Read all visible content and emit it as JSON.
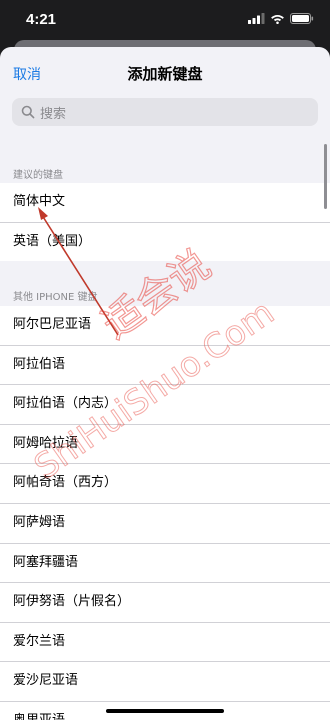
{
  "status_bar": {
    "time": "4:21"
  },
  "nav": {
    "cancel_label": "取消",
    "title": "添加新键盘"
  },
  "search": {
    "placeholder": "搜索"
  },
  "suggested": {
    "header": "建议的键盘",
    "items": [
      {
        "label": "简体中文"
      },
      {
        "label": "英语（美国）"
      }
    ]
  },
  "others": {
    "header": "其他 IPHONE 键盘",
    "items": [
      {
        "label": "阿尔巴尼亚语"
      },
      {
        "label": "阿拉伯语"
      },
      {
        "label": "阿拉伯语（内志）"
      },
      {
        "label": "阿姆哈拉语"
      },
      {
        "label": "阿帕奇语（西方）"
      },
      {
        "label": "阿萨姆语"
      },
      {
        "label": "阿塞拜疆语"
      },
      {
        "label": "阿伊努语（片假名）"
      },
      {
        "label": "爱尔兰语"
      },
      {
        "label": "爱沙尼亚语"
      },
      {
        "label": "奥里亚语"
      }
    ]
  },
  "watermark": {
    "text": "适会说",
    "url": "ShiHuiShuo.Com"
  }
}
